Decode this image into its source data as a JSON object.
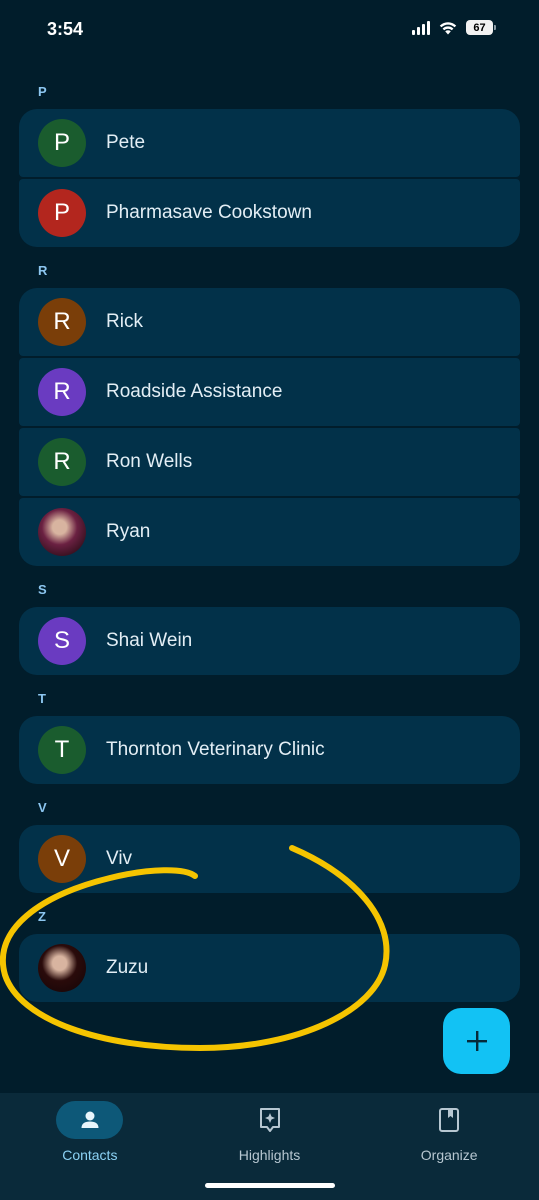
{
  "status_bar": {
    "time": "3:54",
    "battery": "67"
  },
  "sections": [
    {
      "letter": "P",
      "contacts": [
        {
          "name": "Pete",
          "initial": "P",
          "color": "#1a5c2e",
          "avatar": "letter"
        },
        {
          "name": "Pharmasave Cookstown",
          "initial": "P",
          "color": "#b3261e",
          "avatar": "letter"
        }
      ]
    },
    {
      "letter": "R",
      "contacts": [
        {
          "name": "Rick",
          "initial": "R",
          "color": "#7a3e09",
          "avatar": "letter"
        },
        {
          "name": "Roadside Assistance",
          "initial": "R",
          "color": "#6a3bc1",
          "avatar": "letter"
        },
        {
          "name": "Ron Wells",
          "initial": "R",
          "color": "#1a5c2e",
          "avatar": "letter"
        },
        {
          "name": "Ryan",
          "initial": "",
          "color": "#6b2142",
          "avatar": "photo"
        }
      ]
    },
    {
      "letter": "S",
      "contacts": [
        {
          "name": "Shai Wein",
          "initial": "S",
          "color": "#6a3bc1",
          "avatar": "letter"
        }
      ]
    },
    {
      "letter": "T",
      "contacts": [
        {
          "name": "Thornton Veterinary Clinic",
          "initial": "T",
          "color": "#1a5c2e",
          "avatar": "letter"
        }
      ]
    },
    {
      "letter": "V",
      "contacts": [
        {
          "name": "Viv",
          "initial": "V",
          "color": "#7a3e09",
          "avatar": "letter"
        }
      ]
    },
    {
      "letter": "Z",
      "contacts": [
        {
          "name": "Zuzu",
          "initial": "",
          "color": "#2a0b0b",
          "avatar": "photo"
        }
      ]
    }
  ],
  "fab": {
    "icon": "plus-icon"
  },
  "nav": [
    {
      "label": "Contacts",
      "icon": "person-icon",
      "active": true
    },
    {
      "label": "Highlights",
      "icon": "sparkle-icon",
      "active": false
    },
    {
      "label": "Organize",
      "icon": "bookmark-icon",
      "active": false
    }
  ],
  "colors": {
    "background": "#011d2b",
    "card": "#023149",
    "accent": "#12c2f4",
    "annotation": "#f5c400"
  }
}
